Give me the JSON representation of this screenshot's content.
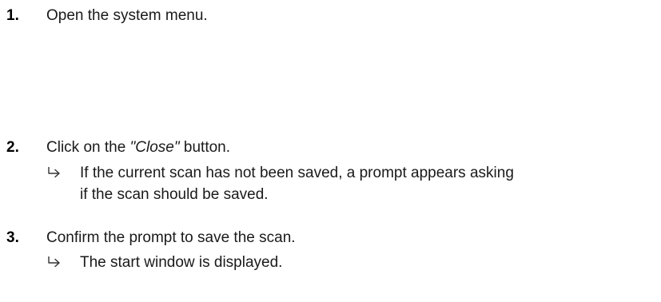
{
  "steps": [
    {
      "number": "1.",
      "text": "Open the system menu."
    },
    {
      "number": "2.",
      "text_before": "Click on the ",
      "emphasis": "\"Close\"",
      "text_after": " button.",
      "result": {
        "icon": "result-arrow-icon",
        "line1": "If the current scan has not been saved, a prompt appears asking",
        "line2": "if the scan should be saved."
      }
    },
    {
      "number": "3.",
      "text": "Confirm the prompt to save the scan.",
      "result": {
        "icon": "result-arrow-icon",
        "line1": "The start window is displayed."
      }
    }
  ]
}
